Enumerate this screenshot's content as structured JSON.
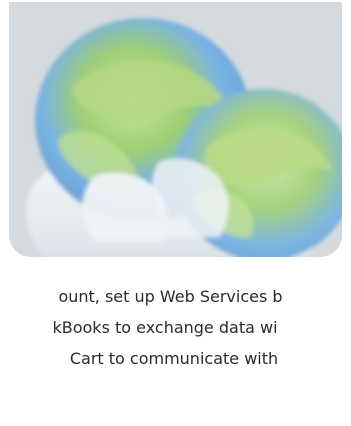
{
  "image": {
    "icon": "globe-network-icon",
    "colors": {
      "card_background": "#d6dbe0",
      "globe_blue": "#6fa7db",
      "globe_green": "#b8d87a",
      "cloud_white": "#eef1f3"
    }
  },
  "description": {
    "lines": [
      "ount, set up Web Services b",
      "kBooks to exchange data wi",
      "Cart to communicate with"
    ]
  }
}
